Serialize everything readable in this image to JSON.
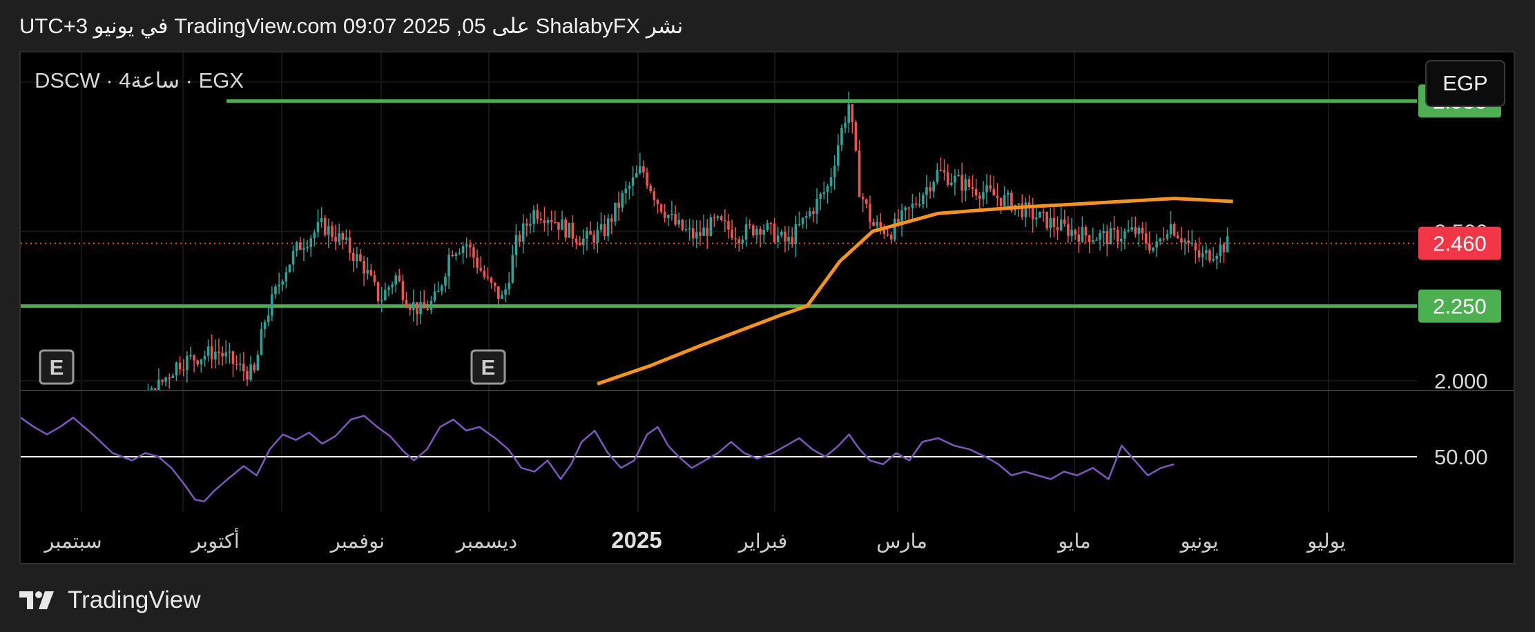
{
  "header": {
    "caption": "نشر ShalabyFX على TradingView.com 09:07 2025 ,05 في يونيو UTC+3"
  },
  "symbol": {
    "title": "DSCW · ساعة4 · EGX"
  },
  "currency_button": {
    "label": "EGP"
  },
  "footer": {
    "brand": "TradingView"
  },
  "colors": {
    "background": "#000000",
    "frame": "#1f1f1f",
    "up_candle": "#26a69a",
    "down_candle": "#ef5350",
    "support_resistance": "#4caf50",
    "moving_average": "#f7931a",
    "rsi": "#7e57c2",
    "last_price_badge": "#f23645",
    "level_badge": "#4caf50"
  },
  "chart_data": [
    {
      "type": "candlestick",
      "title": "DSCW · ساعة4 · EGX",
      "y_axis": {
        "range": [
          1.97,
          3.02
        ],
        "tick_labels": [
          "2.000",
          "2.500",
          "3.000"
        ],
        "position": "right"
      },
      "x_axis": {
        "tick_labels": [
          "سبتمبر",
          "أكتوبر",
          "نوفمبر",
          "ديسمبر",
          "2025",
          "فبراير",
          "مارس",
          "مايو",
          "يونيو",
          "يوليو"
        ],
        "bold_labels": [
          "2025"
        ]
      },
      "grid": true,
      "horizontal_levels": [
        {
          "name": "resistance",
          "value": 2.936,
          "label": "2.936"
        },
        {
          "name": "support",
          "value": 2.25,
          "label": "2.250"
        }
      ],
      "last_price": {
        "value": 2.46,
        "label": "2.460"
      },
      "event_markers": [
        {
          "label": "E"
        },
        {
          "label": "E"
        }
      ],
      "price_path": [
        [
          0,
          1.6
        ],
        [
          50,
          1.7
        ],
        [
          95,
          1.93
        ],
        [
          120,
          2.06
        ],
        [
          150,
          2.1
        ],
        [
          168,
          2.04
        ],
        [
          178,
          2.02
        ],
        [
          186,
          2.2
        ],
        [
          200,
          2.36
        ],
        [
          212,
          2.45
        ],
        [
          230,
          2.52
        ],
        [
          245,
          2.47
        ],
        [
          262,
          2.38
        ],
        [
          274,
          2.27
        ],
        [
          286,
          2.35
        ],
        [
          295,
          2.27
        ],
        [
          306,
          2.23
        ],
        [
          318,
          2.28
        ],
        [
          328,
          2.44
        ],
        [
          340,
          2.46
        ],
        [
          356,
          2.33
        ],
        [
          368,
          2.27
        ],
        [
          378,
          2.46
        ],
        [
          392,
          2.57
        ],
        [
          404,
          2.55
        ],
        [
          418,
          2.5
        ],
        [
          430,
          2.47
        ],
        [
          445,
          2.5
        ],
        [
          460,
          2.62
        ],
        [
          474,
          2.71
        ],
        [
          486,
          2.6
        ],
        [
          500,
          2.52
        ],
        [
          515,
          2.48
        ],
        [
          530,
          2.53
        ],
        [
          548,
          2.49
        ],
        [
          565,
          2.52
        ],
        [
          585,
          2.46
        ],
        [
          600,
          2.55
        ],
        [
          616,
          2.65
        ],
        [
          624,
          2.8
        ],
        [
          632,
          2.93
        ],
        [
          640,
          2.64
        ],
        [
          650,
          2.52
        ],
        [
          664,
          2.5
        ],
        [
          680,
          2.58
        ],
        [
          700,
          2.7
        ],
        [
          718,
          2.66
        ],
        [
          736,
          2.63
        ],
        [
          754,
          2.6
        ],
        [
          770,
          2.56
        ],
        [
          790,
          2.52
        ],
        [
          810,
          2.49
        ],
        [
          830,
          2.48
        ],
        [
          850,
          2.5
        ],
        [
          866,
          2.44
        ],
        [
          876,
          2.53
        ],
        [
          890,
          2.46
        ],
        [
          900,
          2.41
        ],
        [
          912,
          2.44
        ],
        [
          922,
          2.46
        ]
      ],
      "moving_average_path": [
        [
          440,
          1.99
        ],
        [
          480,
          2.05
        ],
        [
          520,
          2.12
        ],
        [
          550,
          2.17
        ],
        [
          580,
          2.22
        ],
        [
          600,
          2.25
        ],
        [
          625,
          2.4
        ],
        [
          650,
          2.5
        ],
        [
          700,
          2.56
        ],
        [
          760,
          2.58
        ],
        [
          800,
          2.59
        ],
        [
          840,
          2.6
        ],
        [
          880,
          2.61
        ],
        [
          925,
          2.6
        ]
      ]
    },
    {
      "type": "line",
      "series": [
        {
          "name": "RSI"
        }
      ],
      "y_axis": {
        "reference_line": 50,
        "tick_labels": [
          "50.00"
        ]
      },
      "values": [
        [
          0,
          71
        ],
        [
          10,
          66
        ],
        [
          20,
          62
        ],
        [
          30,
          66
        ],
        [
          40,
          71
        ],
        [
          55,
          62
        ],
        [
          70,
          52
        ],
        [
          85,
          48
        ],
        [
          95,
          52
        ],
        [
          105,
          50
        ],
        [
          115,
          44
        ],
        [
          125,
          35
        ],
        [
          133,
          27
        ],
        [
          140,
          26
        ],
        [
          148,
          32
        ],
        [
          158,
          38
        ],
        [
          170,
          45
        ],
        [
          180,
          40
        ],
        [
          190,
          54
        ],
        [
          200,
          62
        ],
        [
          210,
          59
        ],
        [
          220,
          63
        ],
        [
          230,
          57
        ],
        [
          240,
          61
        ],
        [
          252,
          70
        ],
        [
          262,
          72
        ],
        [
          272,
          66
        ],
        [
          282,
          61
        ],
        [
          292,
          53
        ],
        [
          300,
          48
        ],
        [
          310,
          54
        ],
        [
          320,
          66
        ],
        [
          330,
          70
        ],
        [
          340,
          64
        ],
        [
          350,
          66
        ],
        [
          362,
          60
        ],
        [
          372,
          54
        ],
        [
          382,
          44
        ],
        [
          392,
          42
        ],
        [
          402,
          48
        ],
        [
          412,
          38
        ],
        [
          420,
          46
        ],
        [
          428,
          58
        ],
        [
          438,
          64
        ],
        [
          448,
          52
        ],
        [
          458,
          44
        ],
        [
          468,
          48
        ],
        [
          478,
          62
        ],
        [
          486,
          66
        ],
        [
          494,
          56
        ],
        [
          502,
          50
        ],
        [
          512,
          44
        ],
        [
          522,
          48
        ],
        [
          532,
          52
        ],
        [
          542,
          58
        ],
        [
          552,
          52
        ],
        [
          562,
          49
        ],
        [
          574,
          52
        ],
        [
          584,
          56
        ],
        [
          594,
          60
        ],
        [
          604,
          54
        ],
        [
          614,
          50
        ],
        [
          624,
          56
        ],
        [
          632,
          62
        ],
        [
          640,
          54
        ],
        [
          648,
          48
        ],
        [
          658,
          46
        ],
        [
          668,
          52
        ],
        [
          678,
          48
        ],
        [
          688,
          58
        ],
        [
          700,
          60
        ],
        [
          712,
          56
        ],
        [
          724,
          54
        ],
        [
          736,
          50
        ],
        [
          746,
          46
        ],
        [
          756,
          40
        ],
        [
          766,
          42
        ],
        [
          776,
          40
        ],
        [
          786,
          38
        ],
        [
          796,
          42
        ],
        [
          806,
          40
        ],
        [
          818,
          44
        ],
        [
          830,
          38
        ],
        [
          840,
          56
        ],
        [
          850,
          48
        ],
        [
          860,
          40
        ],
        [
          870,
          44
        ],
        [
          880,
          46
        ]
      ]
    }
  ]
}
